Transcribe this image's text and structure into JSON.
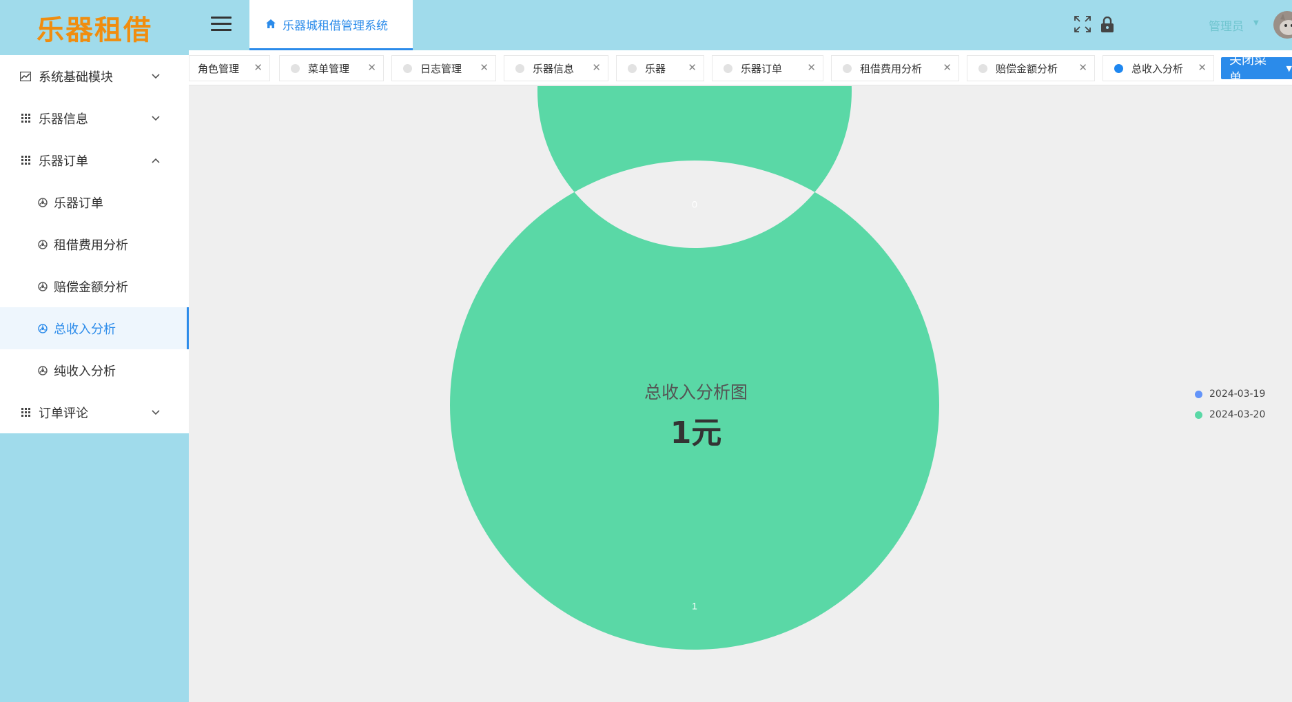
{
  "app": {
    "logo": "乐器租借",
    "system_title": "乐器城租借管理系统",
    "user_name": "管理员"
  },
  "sidebar": {
    "items": [
      {
        "label": "系统基础模块",
        "icon": "chart-icon",
        "expanded": false
      },
      {
        "label": "乐器信息",
        "icon": "grid-icon",
        "expanded": false
      },
      {
        "label": "乐器订单",
        "icon": "grid-icon",
        "expanded": true,
        "children": [
          {
            "label": "乐器订单",
            "icon": "settings-icon",
            "active": false
          },
          {
            "label": "租借费用分析",
            "icon": "settings-icon",
            "active": false
          },
          {
            "label": "赔偿金额分析",
            "icon": "settings-icon",
            "active": false
          },
          {
            "label": "总收入分析",
            "icon": "settings-icon",
            "active": true
          },
          {
            "label": "纯收入分析",
            "icon": "settings-icon",
            "active": false
          }
        ]
      },
      {
        "label": "订单评论",
        "icon": "grid-icon",
        "expanded": false
      }
    ]
  },
  "tabs": [
    {
      "label": "角色管理",
      "active": false
    },
    {
      "label": "菜单管理",
      "active": false
    },
    {
      "label": "日志管理",
      "active": false
    },
    {
      "label": "乐器信息",
      "active": false
    },
    {
      "label": "乐器",
      "active": false
    },
    {
      "label": "乐器订单",
      "active": false
    },
    {
      "label": "租借费用分析",
      "active": false
    },
    {
      "label": "赔偿金额分析",
      "active": false
    },
    {
      "label": "总收入分析",
      "active": true
    }
  ],
  "close_menu_label": "关闭菜单",
  "colors": {
    "accent": "#2b8bea",
    "sidebar_bg": "#a0dbeb",
    "logo": "#f08d0f",
    "series": [
      "#6394f9",
      "#5ad8a6"
    ]
  },
  "chart_data": {
    "type": "pie",
    "variant": "donut",
    "center_title": "总收入分析图",
    "center_value": "1元",
    "categories": [
      "2024-03-19",
      "2024-03-20"
    ],
    "values": [
      0,
      1
    ],
    "slice_labels": [
      "0",
      "1"
    ],
    "legend_position": "right"
  }
}
